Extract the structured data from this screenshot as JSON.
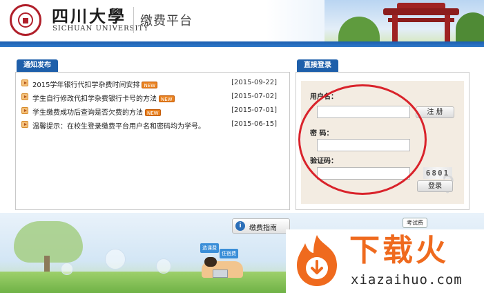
{
  "header": {
    "school_name_cn": "四川大學",
    "school_name_en": "SICHUAN UNIVERSITY",
    "platform_title": "缴费平台"
  },
  "notice": {
    "tab_label": "通知发布",
    "new_badge": "NEW",
    "items": [
      {
        "title": "2015学年银行代扣学杂费时间安排",
        "date": "[2015-09-22]",
        "is_new": true
      },
      {
        "title": "学生自行修改代扣学杂费银行卡号的方法",
        "date": "[2015-07-02]",
        "is_new": true
      },
      {
        "title": "学生缴费成功后查询是否欠费的方法",
        "date": "[2015-07-01]",
        "is_new": true
      },
      {
        "title": "温馨提示：在校生登录缴费平台用户名和密码均为学号。",
        "date": "[2015-06-15]",
        "is_new": false
      }
    ]
  },
  "login": {
    "tab_label": "直接登录",
    "username_label": "用户名：",
    "username_value": "",
    "password_label": "密  码：",
    "password_value": "",
    "captcha_label": "验证码：",
    "captcha_value": "",
    "captcha_image_text": "6801",
    "register_button": "注 册",
    "login_button": "登录"
  },
  "footer": {
    "guide_button": "缴费指南",
    "sign_left": "选课费",
    "sign_right": "住宿费",
    "exam_sign": "考试费"
  },
  "watermark": {
    "brand": "下载火",
    "url": "xiazaihuo.com"
  },
  "colors": {
    "header_band": "#1e5faa",
    "annotation_red": "#d9232b",
    "watermark_orange": "#ef6a1e"
  }
}
